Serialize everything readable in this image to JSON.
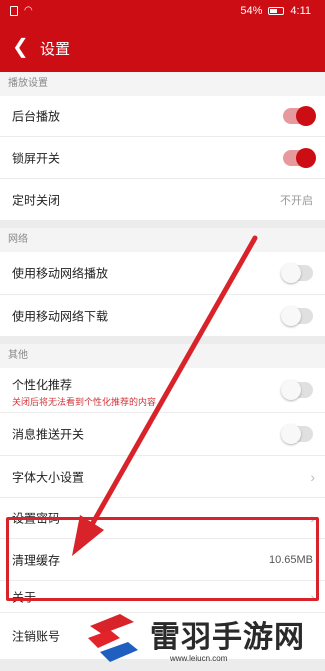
{
  "status_bar": {
    "battery": "54%",
    "time": "4:11"
  },
  "header": {
    "back_icon": "chevron-left-icon",
    "title": "设置"
  },
  "sections": {
    "playback": {
      "title": "播放设置",
      "items": [
        {
          "label": "后台播放",
          "toggle": true
        },
        {
          "label": "锁屏开关",
          "toggle": true
        },
        {
          "label": "定时关闭",
          "value": "不开启"
        }
      ]
    },
    "network": {
      "title": "网络",
      "items": [
        {
          "label": "使用移动网络播放",
          "toggle": false
        },
        {
          "label": "使用移动网络下载",
          "toggle": false
        }
      ]
    },
    "other": {
      "title": "其他",
      "items": [
        {
          "label": "个性化推荐",
          "sublabel": "关闭后将无法看到个性化推荐的内容",
          "toggle": false
        },
        {
          "label": "消息推送开关",
          "toggle": false
        },
        {
          "label": "字体大小设置"
        },
        {
          "label": "设置密码"
        },
        {
          "label": "清理缓存",
          "value": "10.65MB"
        },
        {
          "label": "关于"
        },
        {
          "label": "注销账号"
        }
      ]
    }
  },
  "watermark": {
    "text": "雷羽手游网",
    "url": "www.leiucn.com"
  },
  "colors": {
    "brand": "#cc0d14",
    "annotation": "#d8232a"
  }
}
